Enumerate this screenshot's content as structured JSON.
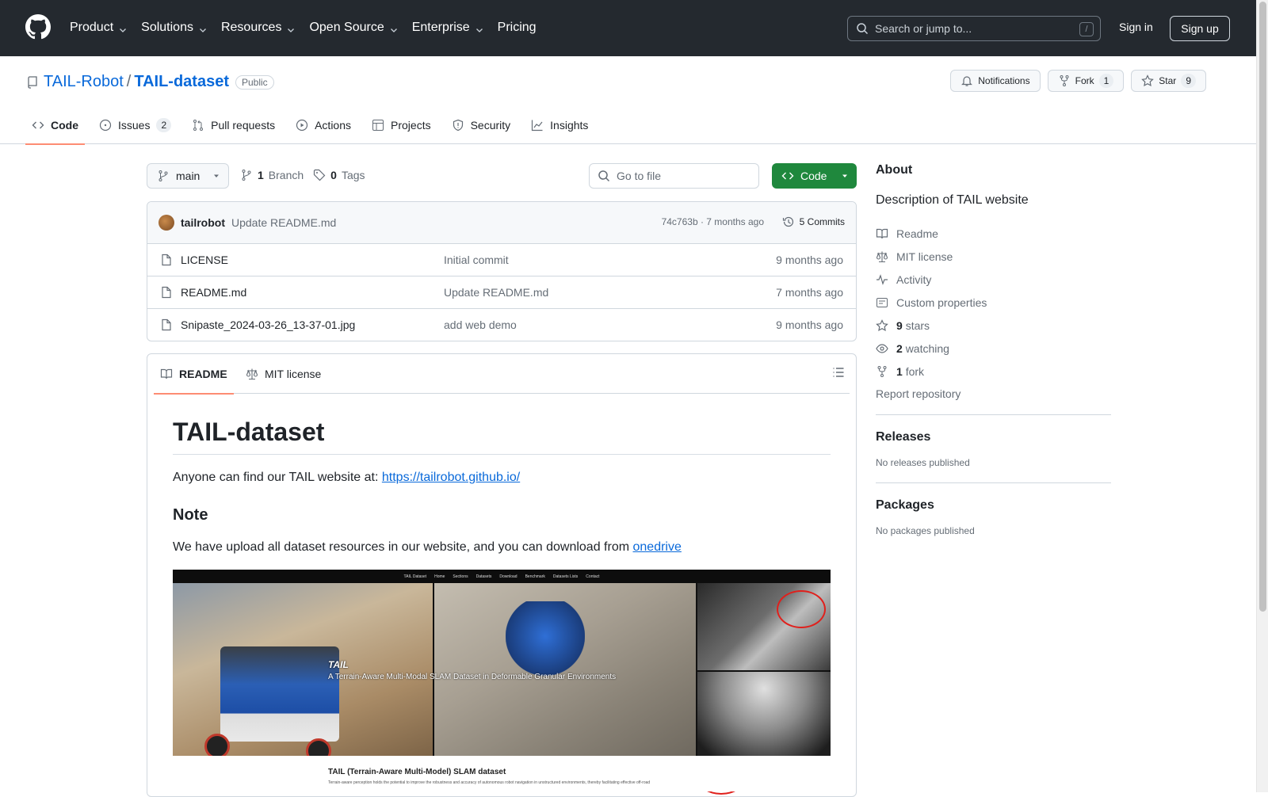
{
  "nav": {
    "items": [
      "Product",
      "Solutions",
      "Resources",
      "Open Source",
      "Enterprise",
      "Pricing"
    ],
    "search_placeholder": "Search or jump to...",
    "search_kbd": "/",
    "signin": "Sign in",
    "signup": "Sign up"
  },
  "repo": {
    "owner": "TAIL-Robot",
    "sep": "/",
    "name": "TAIL-dataset",
    "visibility": "Public",
    "notifications": "Notifications",
    "fork_label": "Fork",
    "fork_count": "1",
    "star_label": "Star",
    "star_count": "9"
  },
  "tabs": {
    "code": "Code",
    "issues": "Issues",
    "issues_count": "2",
    "pulls": "Pull requests",
    "actions": "Actions",
    "projects": "Projects",
    "security": "Security",
    "insights": "Insights"
  },
  "branchbar": {
    "branch": "main",
    "branch_count": "1",
    "branch_label": "Branch",
    "tag_count": "0",
    "tag_label": "Tags",
    "goto_placeholder": "Go to file",
    "code_button": "Code"
  },
  "commit": {
    "author": "tailrobot",
    "message": "Update README.md",
    "meta": "74c763b · 7 months ago",
    "commits": "5 Commits"
  },
  "files": [
    {
      "name": "LICENSE",
      "message": "Initial commit",
      "age": "9 months ago"
    },
    {
      "name": "README.md",
      "message": "Update README.md",
      "age": "7 months ago"
    },
    {
      "name": "Snipaste_2024-03-26_13-37-01.jpg",
      "message": "add web demo",
      "age": "9 months ago"
    }
  ],
  "readme": {
    "tab_readme": "README",
    "tab_license": "MIT license",
    "title": "TAIL-dataset",
    "intro": "Anyone can find our TAIL website at:",
    "intro_link": "https://tailrobot.github.io/",
    "note_heading": "Note",
    "note_text": "We have upload all dataset resources in our website, and you can download from",
    "note_link": "onedrive",
    "image": {
      "nav": [
        "TAIL Dataset",
        "Home",
        "Sections",
        "Datasets",
        "Download",
        "Benchmark",
        "Datasets Lists",
        "Contact"
      ],
      "overlay_title": "TAIL",
      "overlay_subtitle": "A Terrain-Aware Multi-Modal SLAM Dataset in Deformable Granular Environments",
      "bottom_title": "TAIL (Terrain-Aware Multi-Model) SLAM dataset",
      "bottom_text": "Terrain-aware perception holds the potential to improve the robustness and accuracy of autonomous robot navigation in unstructured environments, thereby facilitating effective off-road"
    }
  },
  "sidebar": {
    "about": "About",
    "description": "Description of TAIL website",
    "readme": "Readme",
    "license": "MIT license",
    "activity": "Activity",
    "custom_props": "Custom properties",
    "stars_count": "9",
    "stars_label": "stars",
    "watching_count": "2",
    "watching_label": "watching",
    "fork_count": "1",
    "fork_label": "fork",
    "report": "Report repository",
    "releases": "Releases",
    "no_releases": "No releases published",
    "packages": "Packages",
    "no_packages": "No packages published"
  },
  "colors": {
    "header_bg": "#24292f",
    "link": "#0969da",
    "code_button": "#1f883d",
    "active_tab": "#fd8c73"
  }
}
